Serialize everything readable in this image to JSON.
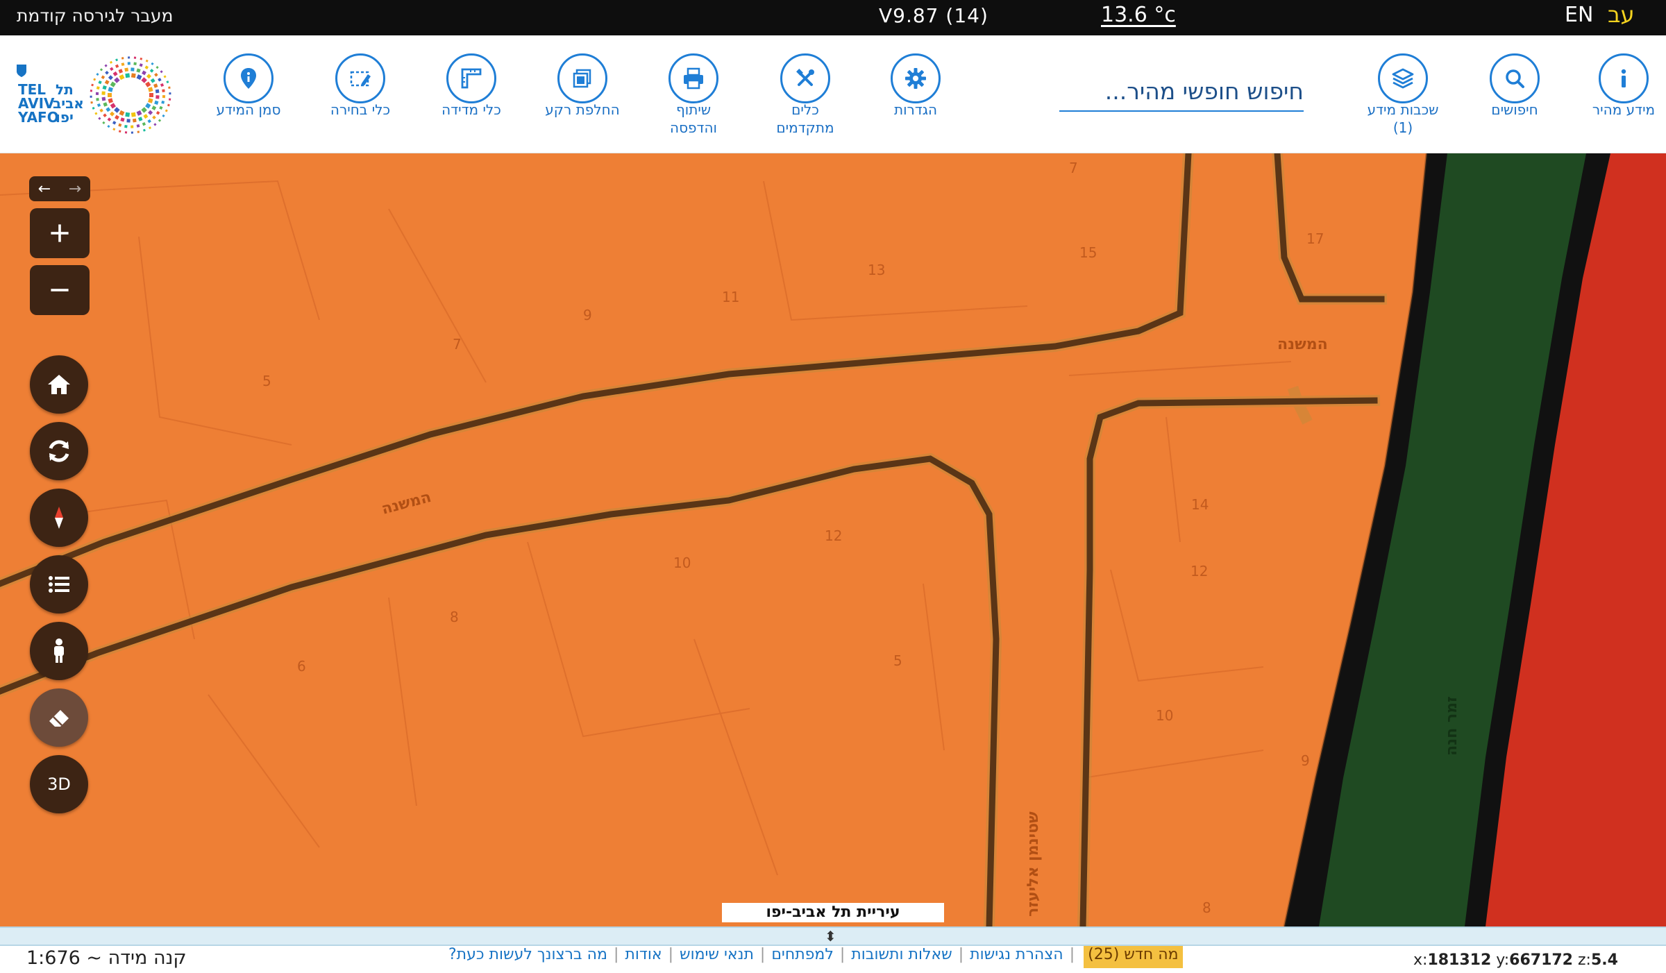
{
  "topbar": {
    "previous_version": "מעבר לגירסה קודמת",
    "version": "V9.87 (14)",
    "temperature": "13.6 °c",
    "lang_en": "EN",
    "lang_he": "עב"
  },
  "toolbar": {
    "quick_info": "מידע מהיר",
    "searches": "חיפושים",
    "layers_line1": "שכבות מידע",
    "layers_count": "(1)",
    "search_placeholder": "חיפוש חופשי מהיר...",
    "settings": "הגדרות",
    "advanced_tools_line1": "כלים",
    "advanced_tools_line2": "מתקדמים",
    "share_print_line1": "שיתוף",
    "share_print_line2": "והדפסה",
    "basemap": "החלפת רקע",
    "measure": "כלי מדידה",
    "select": "כלי בחירה",
    "marker": "סמן המידע",
    "logo_he_top": "תל",
    "logo_he_mid": "אביב",
    "logo_he_bot": "יפו",
    "logo_en_top": "TEL",
    "logo_en_mid": "AVIV",
    "logo_en_bot": "YAFO"
  },
  "map": {
    "ctrl_3d": "3D",
    "attribution": "עיריית תל אביב-יפו",
    "street_mishna_1": "המשנה",
    "street_mishna_2": "המשנה",
    "street_zemer": "זמר חנה",
    "street_shtein": "שטינמן אליעזר",
    "numbers": [
      "7",
      "13",
      "15",
      "17",
      "11",
      "9",
      "7",
      "5",
      "14",
      "12",
      "12",
      "10",
      "8",
      "6",
      "5",
      "10",
      "9",
      "8"
    ]
  },
  "footer": {
    "scale": "קנה מידה ~ 1:676",
    "links": [
      "מה ברצונך לעשות כעת?",
      "אודות",
      "תנאי שימוש",
      "למפתחים",
      "שאלות ותשובות",
      "הצהרת נגישות"
    ],
    "whats_new": "מה חדש (25)",
    "x_label": "x:",
    "x_value": "181312",
    "y_label": "y:",
    "y_value": "667172",
    "z_label": "z:",
    "z_value": "5.4"
  },
  "colors": {
    "orange_zone": "#ee7f35",
    "green_strip": "#1f4a22",
    "red_zone": "#d0301f",
    "control_bg": "#3d2414",
    "accent_blue": "#1f7ed6"
  }
}
